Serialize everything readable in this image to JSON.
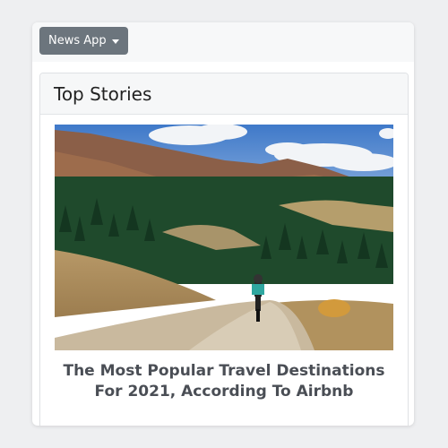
{
  "nav": {
    "dropdown_label": "News App"
  },
  "panel": {
    "title": "Top Stories"
  },
  "story": {
    "title": "The Most Popular Travel Destinations For 2021, According To Airbnb"
  }
}
